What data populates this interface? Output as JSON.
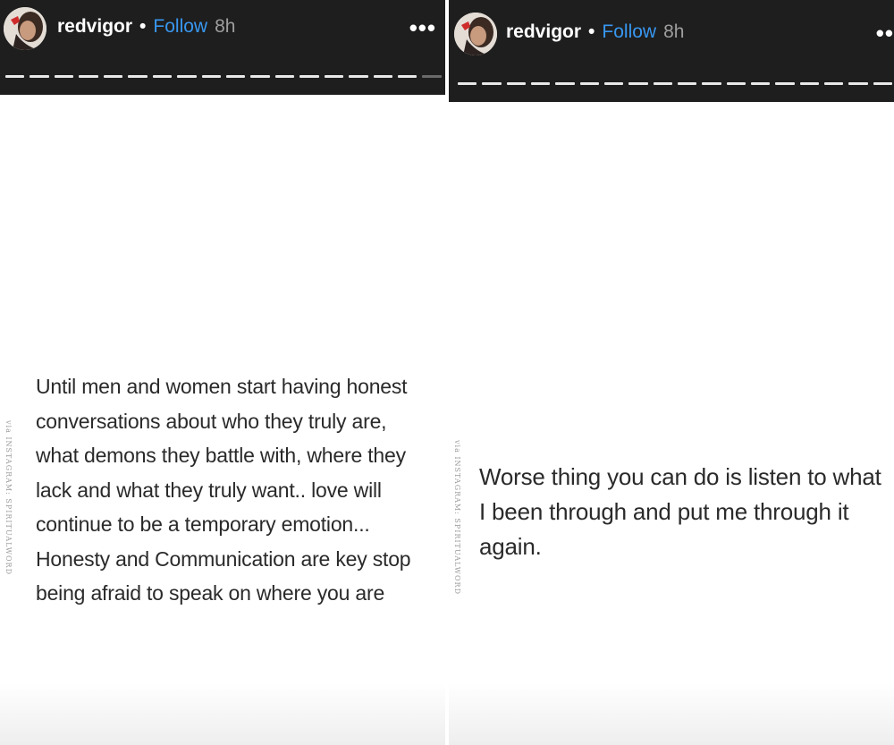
{
  "stories": [
    {
      "username": "redvigor",
      "separator": "•",
      "follow_label": "Follow",
      "time": "8h",
      "more_icon": "more-horizontal-icon",
      "progress_segments": 18,
      "progress_active": 17,
      "watermark": "via INSTAGRAM: SPIRITUALWORD",
      "text": "Until men and women start having honest conversations about who they truly are, what demons they battle with, where they lack and what they truly want.. love will continue to be a temporary emotion... Honesty and Communication are key stop being afraid to speak on where you are"
    },
    {
      "username": "redvigor",
      "separator": "•",
      "follow_label": "Follow",
      "time": "8h",
      "more_icon": "more-horizontal-icon",
      "progress_segments": 18,
      "progress_active": 18,
      "watermark": "via INSTAGRAM: SPIRITUALWORD",
      "text": "Worse thing you can do is listen to what I been through and put me through it again."
    }
  ],
  "colors": {
    "header_bg": "#1e1e1e",
    "follow": "#3897f0",
    "time": "#9e9e9e",
    "text": "#2a2a2a"
  }
}
